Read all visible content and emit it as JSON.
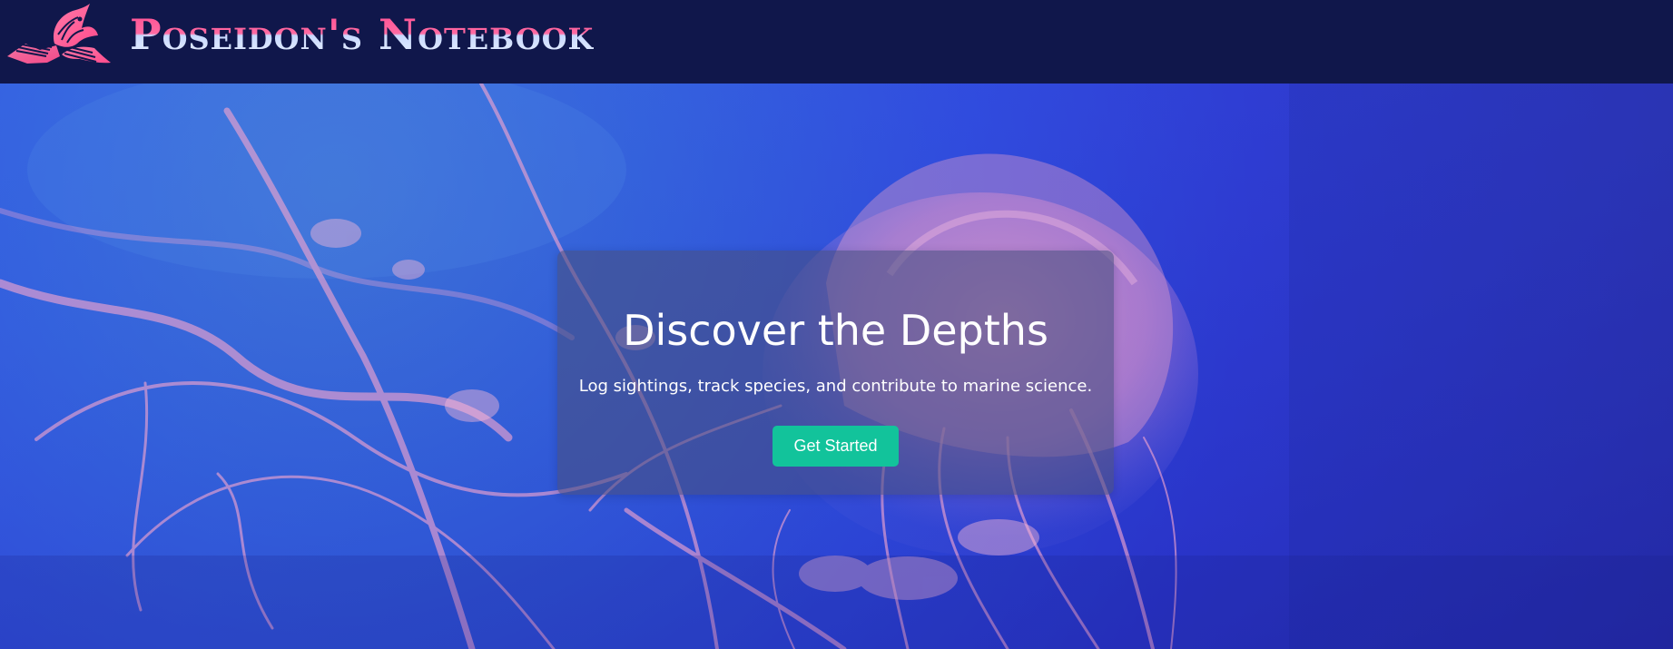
{
  "brand": {
    "title": "Poseidon's Notebook",
    "logo_icon": "book-fish-logo-icon"
  },
  "hero": {
    "heading": "Discover the Depths",
    "subtitle": "Log sightings, track species, and contribute to marine science.",
    "cta_label": "Get Started",
    "background_image": "jellyfish-underwater-photo"
  },
  "colors": {
    "header_background": "#10174b",
    "brand_pink": "#ff4f93",
    "cta_green": "#12c39b",
    "hero_blue": "#2a45e4"
  }
}
